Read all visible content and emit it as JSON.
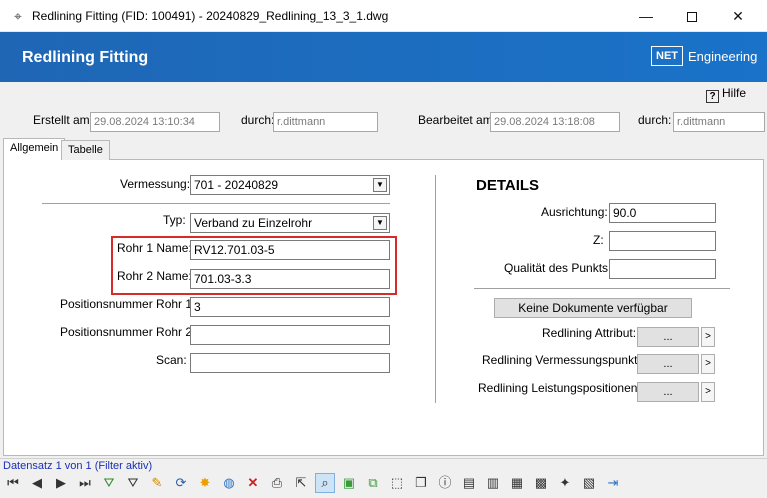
{
  "window": {
    "title": "Redlining Fitting (FID: 100491) - 20240829_Redlining_13_3_1.dwg",
    "controls": {
      "minimize": "—",
      "close": "✕"
    }
  },
  "header": {
    "title": "Redlining Fitting",
    "logo_box": "NET",
    "logo_text": "Engineering"
  },
  "help": {
    "icon": "?",
    "label": "Hilfe"
  },
  "meta": {
    "created_label": "Erstellt am:",
    "created_value": "29.08.2024 13:10:34",
    "created_by_label": "durch:",
    "created_by_value": "r.dittmann",
    "edited_label": "Bearbeitet am:",
    "edited_value": "29.08.2024 13:18:08",
    "edited_by_label": "durch:",
    "edited_by_value": "r.dittmann"
  },
  "tabs": [
    {
      "label": "Allgemein",
      "selected": true
    },
    {
      "label": "Tabelle",
      "selected": false
    }
  ],
  "form": {
    "vermessung_label": "Vermessung:",
    "vermessung_value": "701 - 20240829",
    "typ_label": "Typ:",
    "typ_value": "Verband zu Einzelrohr",
    "rohr1_label": "Rohr 1 Name:",
    "rohr1_value": "RV12.701.03-5",
    "rohr2_label": "Rohr 2 Name:",
    "rohr2_value": "701.03-3.3",
    "pos1_label": "Positionsnummer Rohr 1:",
    "pos1_value": "3",
    "pos2_label": "Positionsnummer Rohr 2:",
    "pos2_value": "",
    "scan_label": "Scan:",
    "scan_value": "",
    "dropdown_arrow": "▼"
  },
  "details": {
    "title": "DETAILS",
    "ausrichtung_label": "Ausrichtung:",
    "ausrichtung_value": "90.0",
    "z_label": "Z:",
    "z_value": "",
    "qualitaet_label": "Qualität des Punkts:",
    "qualitaet_value": "",
    "documents_button": "Keine Dokumente verfügbar",
    "attr_label": "Redlining Attribut:",
    "vp_label": "Redlining Vermessungspunkt:",
    "lp_label": "Redlining Leistungspositionen:",
    "ellipsis": "...",
    "arrow": ">"
  },
  "status": {
    "record_text": "Datensatz 1 von 1 (Filter aktiv)"
  },
  "toolbar_icons": [
    "first-record-icon",
    "previous-record-icon",
    "next-record-icon",
    "last-record-icon",
    "filter-add-icon",
    "filter-icon",
    "edit-pencil-icon",
    "refresh-icon",
    "star-icon",
    "globe-icon",
    "delete-icon",
    "print-icon",
    "select-pointer-icon",
    "zoom-icon",
    "box-3d-icon",
    "copy-objects-icon",
    "dashed-select-icon",
    "layers-icon",
    "info-icon",
    "document-icon",
    "document-edit-icon",
    "image-search-icon",
    "grid-icon",
    "sparkle-icon",
    "table-edit-icon",
    "exit-icon"
  ]
}
